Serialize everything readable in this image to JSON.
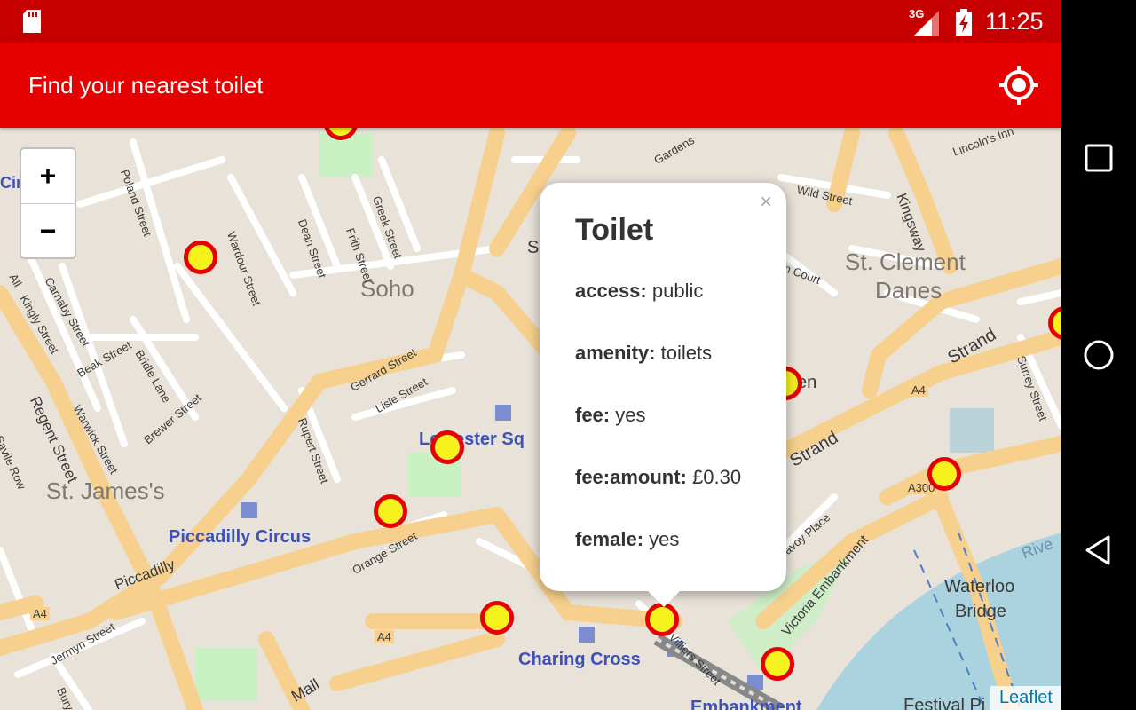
{
  "status_bar": {
    "network": "3G",
    "time": "11:25"
  },
  "app_bar": {
    "title": "Find your nearest toilet",
    "locate_icon": "gps-locate-icon"
  },
  "zoom": {
    "in": "+",
    "out": "−"
  },
  "map_labels": {
    "soho": "Soho",
    "st_clement": "St. Clement",
    "danes": "Danes",
    "st_james": "St. James's",
    "piccadilly_circus": "Piccadilly Circus",
    "leicester_sq": "Leicester Sq",
    "charing_cross": "Charing Cross",
    "waterloo": "Waterloo",
    "bridge": "Bridge",
    "embankment": "Embankment",
    "festival_pier": "Festival Pi",
    "wardour": "Wardour Street",
    "dean": "Dean Street",
    "frith": "Frith Street",
    "greek": "Greek Street",
    "poland": "Poland Street",
    "carnaby": "Carnaby Street",
    "kingly": "Kingly Street",
    "beak": "Beak Street",
    "bridle": "Bridle Lane",
    "warwick": "Warwick Street",
    "brewer": "Brewer Street",
    "regent": "Regent Street",
    "savile": "Savile Row",
    "gerrard": "Gerrard Street",
    "lisle": "Lisle Street",
    "rupert": "Rupert Street",
    "orange": "Orange Street",
    "piccadilly": "Piccadilly",
    "jermyn": "Jermyn Street",
    "bury": "Bury St",
    "mall": "Mall",
    "strand": "Strand",
    "kingsway": "Kingsway",
    "wild": "Wild Street",
    "surrey": "Surrey Street",
    "victoria_emb": "Victoria Embankment",
    "villiers": "Villiers Street",
    "savoy": "Savoy Place",
    "gardens": "Gardens",
    "lincolns": "Lincoln's Inn",
    "court": "n Court",
    "sev": "Sev",
    "en": "en",
    "a4_1": "A4",
    "a4_2": "A4",
    "a4_3": "A4",
    "a300": "A300",
    "river": "Rive",
    "circ": "Cir",
    "all": "All"
  },
  "popup": {
    "title": "Toilet",
    "close": "×",
    "rows": [
      {
        "key": "access:",
        "value": "public"
      },
      {
        "key": "amenity:",
        "value": "toilets"
      },
      {
        "key": "fee:",
        "value": "yes"
      },
      {
        "key": "fee:amount:",
        "value": "£0.30"
      },
      {
        "key": "female:",
        "value": "yes"
      }
    ]
  },
  "markers": [
    {
      "name": "toilet-marker-soho-square"
    },
    {
      "name": "toilet-marker-carnaby"
    },
    {
      "name": "toilet-marker-leicester-sq"
    },
    {
      "name": "toilet-marker-chinatown"
    },
    {
      "name": "toilet-marker-trafalgar"
    },
    {
      "name": "toilet-marker-charing-cross"
    },
    {
      "name": "toilet-marker-embankment"
    },
    {
      "name": "toilet-marker-covent-garden"
    },
    {
      "name": "toilet-marker-strand"
    },
    {
      "name": "toilet-marker-aldwych"
    }
  ],
  "attribution": "Leaflet",
  "colors": {
    "status_bar": "#c60000",
    "app_bar": "#e60000",
    "marker_fill": "#f5f21e",
    "marker_border": "#e60000"
  },
  "nav": {
    "back": "back-icon",
    "home": "home-icon",
    "recents": "recents-icon"
  }
}
